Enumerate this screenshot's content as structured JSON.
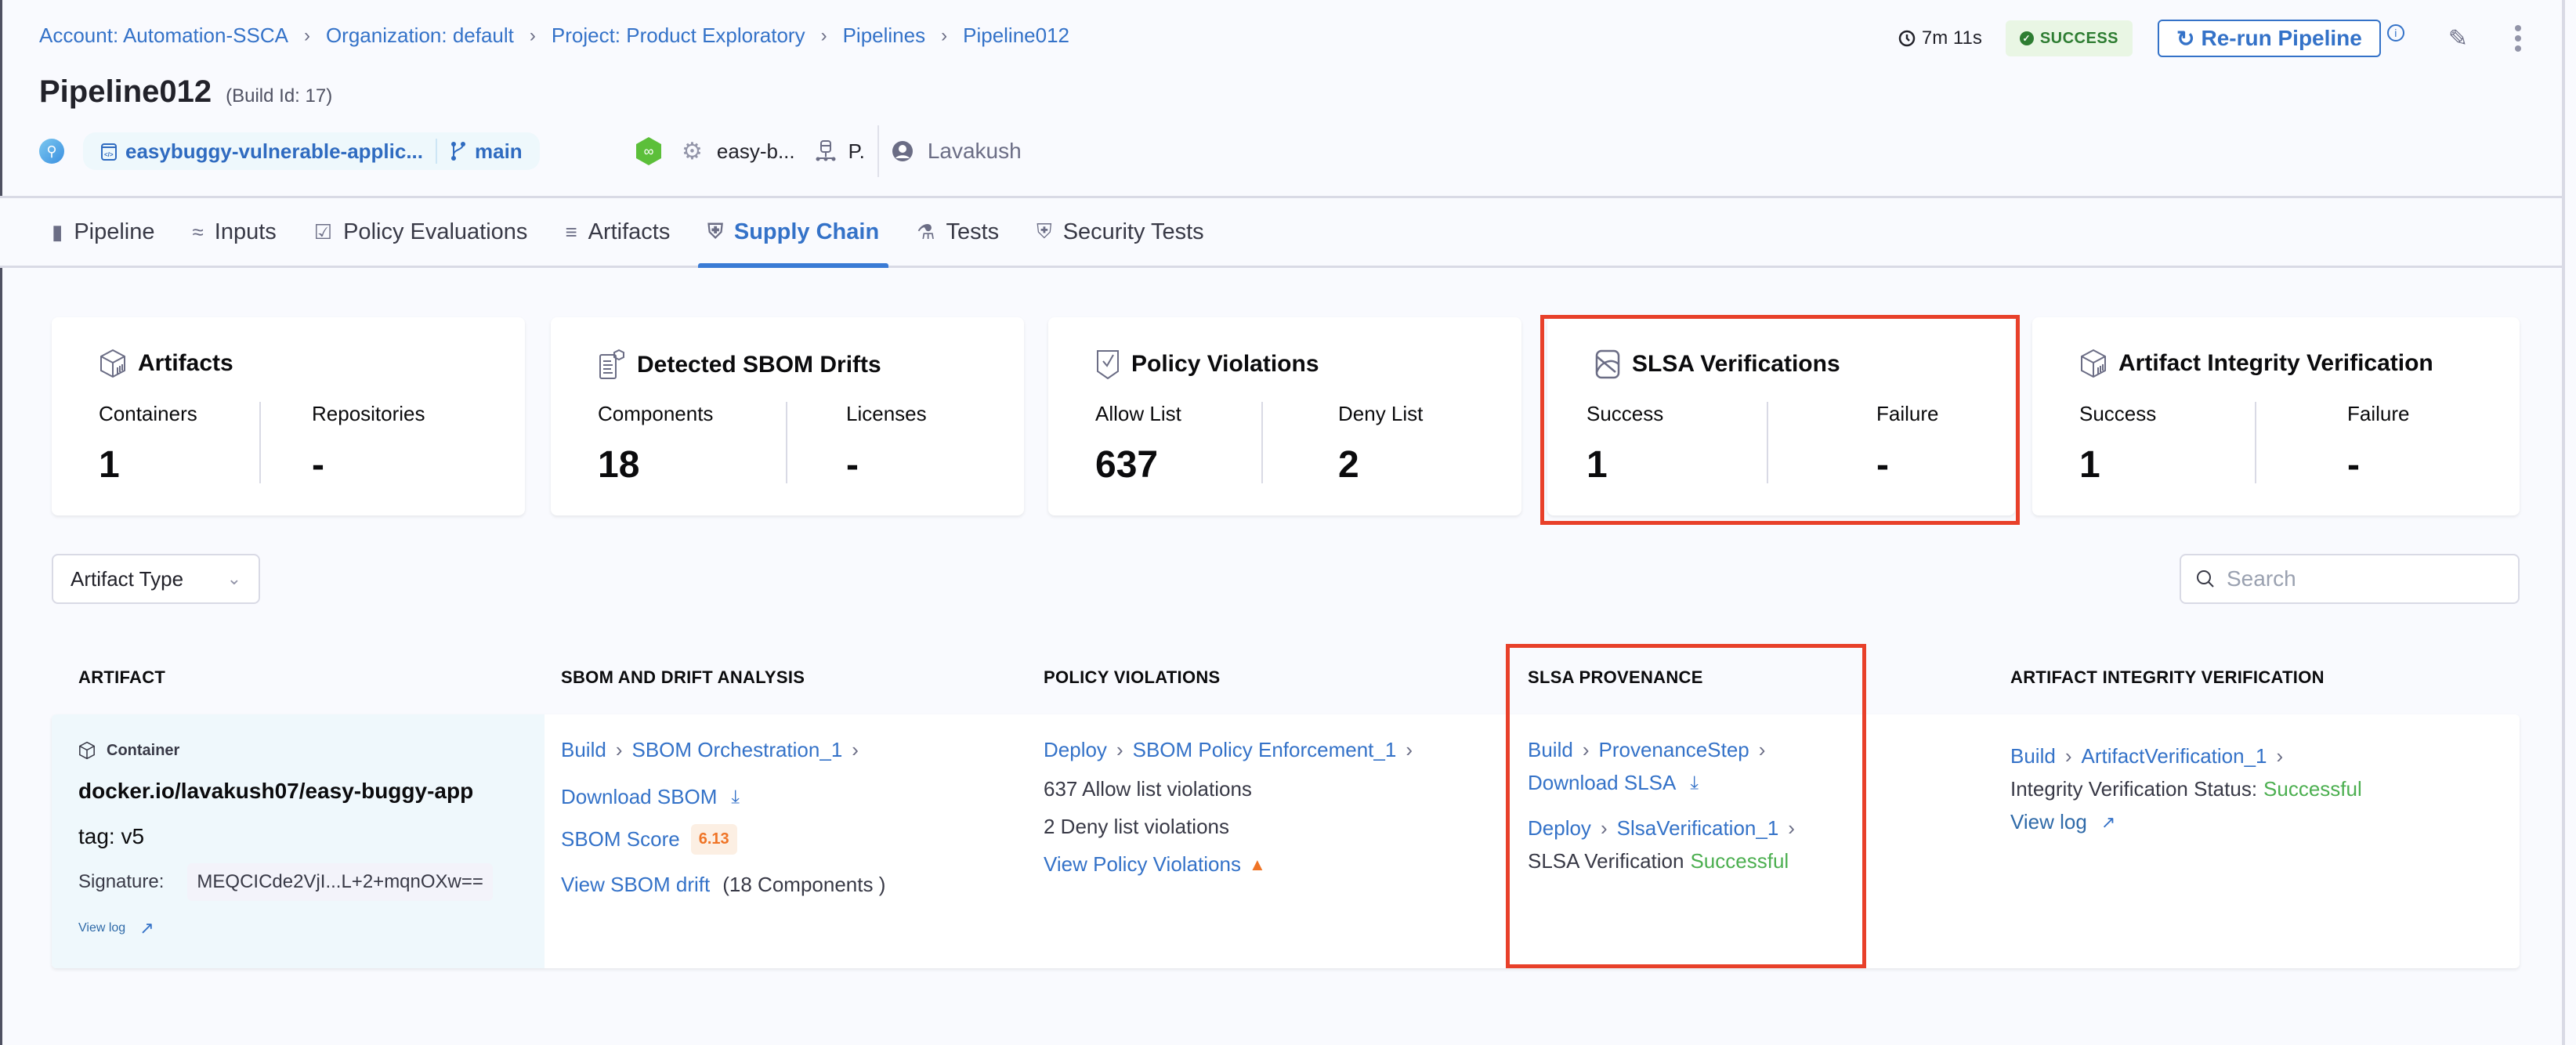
{
  "breadcrumb": [
    {
      "label": "Account: Automation-SSCA"
    },
    {
      "label": "Organization: default"
    },
    {
      "label": "Project: Product Exploratory"
    },
    {
      "label": "Pipelines"
    },
    {
      "label": "Pipeline012"
    }
  ],
  "header": {
    "title": "Pipeline012",
    "build_id": "(Build Id: 17)",
    "repo": "easybuggy-vulnerable-applic...",
    "branch": "main",
    "service": "easy-b...",
    "infra": "P.",
    "user": "Lavakush",
    "duration": "7m 11s",
    "status": "SUCCESS",
    "rerun_label": "Re-run Pipeline"
  },
  "colors": {
    "accent": "#3472c8",
    "success": "#2e7d32",
    "success_bg": "#e9f6e4",
    "highlight": "#e8402a",
    "score": "#ef7426"
  },
  "tabs": [
    {
      "label": "Pipeline",
      "icon": "pipeline-icon"
    },
    {
      "label": "Inputs",
      "icon": "inputs-icon"
    },
    {
      "label": "Policy Evaluations",
      "icon": "shield-check-icon"
    },
    {
      "label": "Artifacts",
      "icon": "artifacts-icon"
    },
    {
      "label": "Supply Chain",
      "icon": "supply-chain-icon",
      "active": true
    },
    {
      "label": "Tests",
      "icon": "flask-icon"
    },
    {
      "label": "Security Tests",
      "icon": "security-shield-icon"
    }
  ],
  "cards": [
    {
      "title": "Artifacts",
      "icon": "cube-icon",
      "left": {
        "label": "Containers",
        "value": "1"
      },
      "right": {
        "label": "Repositories",
        "value": "-"
      }
    },
    {
      "title": "Detected SBOM Drifts",
      "icon": "sbom-document-icon",
      "left": {
        "label": "Components",
        "value": "18"
      },
      "right": {
        "label": "Licenses",
        "value": "-"
      }
    },
    {
      "title": "Policy Violations",
      "icon": "shield-check-icon",
      "left": {
        "label": "Allow List",
        "value": "637"
      },
      "right": {
        "label": "Deny List",
        "value": "2"
      }
    },
    {
      "title": "SLSA Verifications",
      "icon": "slsa-icon",
      "left": {
        "label": "Success",
        "value": "1"
      },
      "right": {
        "label": "Failure",
        "value": "-"
      }
    },
    {
      "title": "Artifact Integrity Verification",
      "icon": "cube-icon",
      "left": {
        "label": "Success",
        "value": "1"
      },
      "right": {
        "label": "Failure",
        "value": "-"
      }
    }
  ],
  "filters": {
    "artifact_type_label": "Artifact Type",
    "search_placeholder": "Search"
  },
  "table": {
    "headers": [
      "ARTIFACT",
      "SBOM AND DRIFT ANALYSIS",
      "POLICY VIOLATIONS",
      "SLSA PROVENANCE",
      "ARTIFACT INTEGRITY VERIFICATION"
    ],
    "row": {
      "artifact": {
        "type": "Container",
        "name": "docker.io/lavakush07/easy-buggy-app",
        "tag": "tag: v5",
        "signature_label": "Signature:",
        "signature": "MEQCICde2VjI...L+2+mqnOXw==",
        "view_log": "View log"
      },
      "sbom": {
        "stage": "Build",
        "step": "SBOM Orchestration_1",
        "download": "Download SBOM",
        "score_label": "SBOM Score",
        "score": "6.13",
        "drift_link": "View SBOM drift",
        "drift_count": "(18 Components )"
      },
      "policy": {
        "stage": "Deploy",
        "step": "SBOM Policy Enforcement_1",
        "allow": "637 Allow list violations",
        "deny": "2 Deny list violations",
        "view": "View Policy Violations"
      },
      "slsa": {
        "stage": "Build",
        "step": "ProvenanceStep",
        "download": "Download SLSA",
        "verify_stage": "Deploy",
        "verify_step": "SlsaVerification_1",
        "verify_label": "SLSA Verification",
        "verify_status": "Successful"
      },
      "integrity": {
        "stage": "Build",
        "step": "ArtifactVerification_1",
        "status_label": "Integrity Verification Status:",
        "status": "Successful",
        "view_log": "View log"
      }
    }
  }
}
